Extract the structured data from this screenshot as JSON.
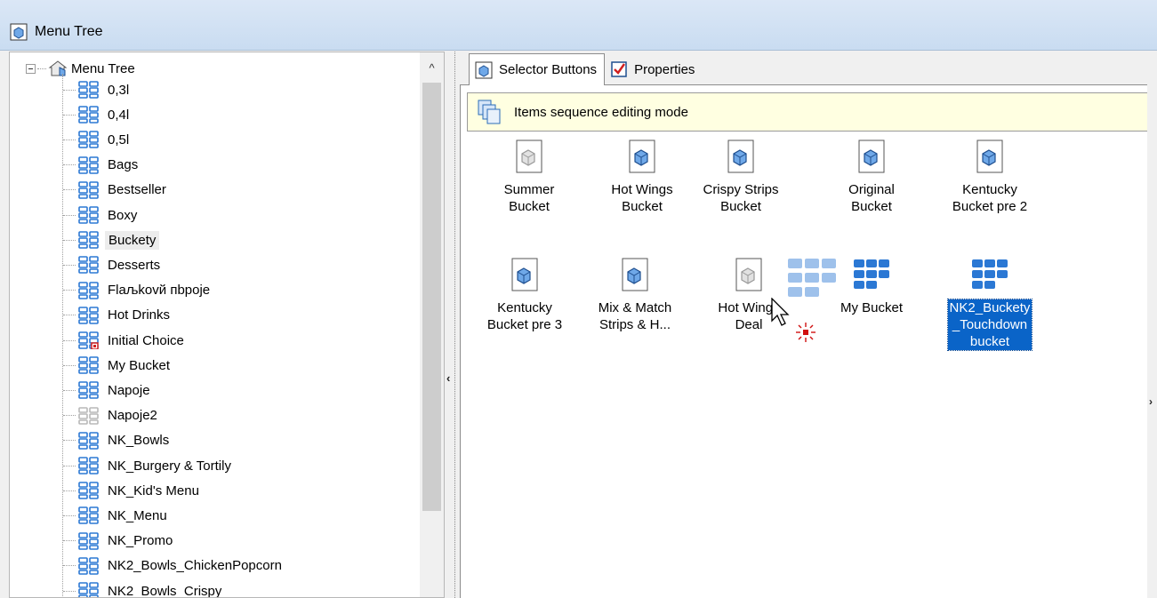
{
  "window": {
    "title": "Menu Tree"
  },
  "tree": {
    "root_label": "Menu Tree",
    "items": [
      {
        "label": "0,3l",
        "icon": "grid-icon"
      },
      {
        "label": "0,4l",
        "icon": "grid-icon"
      },
      {
        "label": "0,5l",
        "icon": "grid-icon"
      },
      {
        "label": "Bags",
        "icon": "grid-icon"
      },
      {
        "label": "Bestseller",
        "icon": "grid-icon"
      },
      {
        "label": "Boxy",
        "icon": "grid-icon"
      },
      {
        "label": "Buckety",
        "icon": "grid-icon",
        "selected": true
      },
      {
        "label": "Desserts",
        "icon": "grid-icon"
      },
      {
        "label": "Flaљkovй пbpoje",
        "icon": "grid-icon"
      },
      {
        "label": "Hot Drinks",
        "icon": "grid-icon"
      },
      {
        "label": "Initial Choice",
        "icon": "grid-initial-icon"
      },
      {
        "label": "My Bucket",
        "icon": "grid-icon"
      },
      {
        "label": "Napoje",
        "icon": "grid-icon"
      },
      {
        "label": "Napoje2",
        "icon": "grid-gray-icon"
      },
      {
        "label": "NK_Bowls",
        "icon": "grid-icon"
      },
      {
        "label": "NK_Burgery & Tortily",
        "icon": "grid-icon"
      },
      {
        "label": "NK_Kid's Menu",
        "icon": "grid-icon"
      },
      {
        "label": "NK_Menu",
        "icon": "grid-icon"
      },
      {
        "label": "NK_Promo",
        "icon": "grid-icon"
      },
      {
        "label": "NK2_Bowls_ChickenPopcorn",
        "icon": "grid-icon"
      },
      {
        "label": "NK2_Bowls_Crispy",
        "icon": "grid-icon"
      }
    ]
  },
  "tabs": [
    {
      "label": "Selector Buttons",
      "icon": "selector-icon",
      "active": true
    },
    {
      "label": "Properties",
      "icon": "properties-icon",
      "active": false
    }
  ],
  "banner": {
    "text": "Items sequence editing mode"
  },
  "buttons": [
    {
      "label": "Summer\nBucket",
      "icon": "doc-gray-icon"
    },
    {
      "label": "Hot Wings\nBucket",
      "icon": "doc-blue-icon"
    },
    {
      "label": "Crispy Strips\nBucket",
      "icon": "doc-blue-icon"
    },
    {
      "label": "Original\nBucket",
      "icon": "doc-blue-icon"
    },
    {
      "label": "Kentucky\nBucket pre 2",
      "icon": "doc-blue-icon"
    },
    {
      "label": "Kentucky\nBucket pre 3",
      "icon": "doc-blue-icon"
    },
    {
      "label": "Mix & Match\nStrips & H...",
      "icon": "doc-blue-icon"
    },
    {
      "label": "Hot Wings\nDeal",
      "icon": "doc-gray-icon"
    },
    {
      "label": "My Bucket",
      "icon": "grid-big-icon"
    },
    {
      "label": "NK2_Buckety\n_Touchdown\nbucket",
      "icon": "grid-big-icon",
      "selected": true
    }
  ],
  "colors": {
    "selection": "#0a64c8",
    "banner_bg": "#ffffe1",
    "icon_blue": "#2b78d4"
  }
}
